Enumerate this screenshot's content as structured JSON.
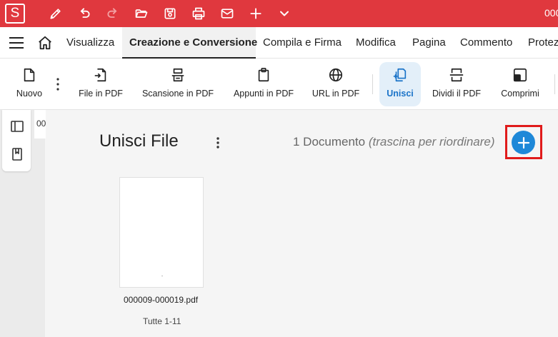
{
  "titlebar": {
    "logo_letter": "S",
    "title_fragment": "000",
    "icons": [
      "pen-icon",
      "undo-icon",
      "redo-icon",
      "open-folder-icon",
      "save-icon",
      "print-icon",
      "mail-icon",
      "plus-icon",
      "chevron-down-icon"
    ],
    "color": "#e0383e"
  },
  "menubar": {
    "items": [
      "Visualizza",
      "Creazione e Conversione",
      "Compila e Firma",
      "Modifica",
      "Pagina",
      "Commento",
      "Protez"
    ],
    "active": "Creazione e Conversione"
  },
  "ribbon": {
    "buttons": [
      {
        "label": "Nuovo",
        "icon": "new-document-icon"
      },
      {
        "label": "File in PDF",
        "icon": "file-to-pdf-icon"
      },
      {
        "label": "Scansione in PDF",
        "icon": "scanner-icon"
      },
      {
        "label": "Appunti in PDF",
        "icon": "clipboard-icon"
      },
      {
        "label": "URL in PDF",
        "icon": "globe-icon"
      },
      {
        "label": "Unisci",
        "icon": "merge-icon"
      },
      {
        "label": "Dividi il PDF",
        "icon": "split-icon"
      },
      {
        "label": "Comprimi",
        "icon": "compress-icon"
      }
    ],
    "active": "Unisci",
    "accent": "#1a73c8"
  },
  "workspace": {
    "tab_fragment": "00",
    "merge_title": "Unisci File",
    "doc_count": "1 Documento",
    "doc_hint": "(trascina per riordinare)",
    "add_button_color": "#1e88d8",
    "files": [
      {
        "name": "000009-000019.pdf",
        "range": "Tutte 1-11"
      }
    ]
  }
}
